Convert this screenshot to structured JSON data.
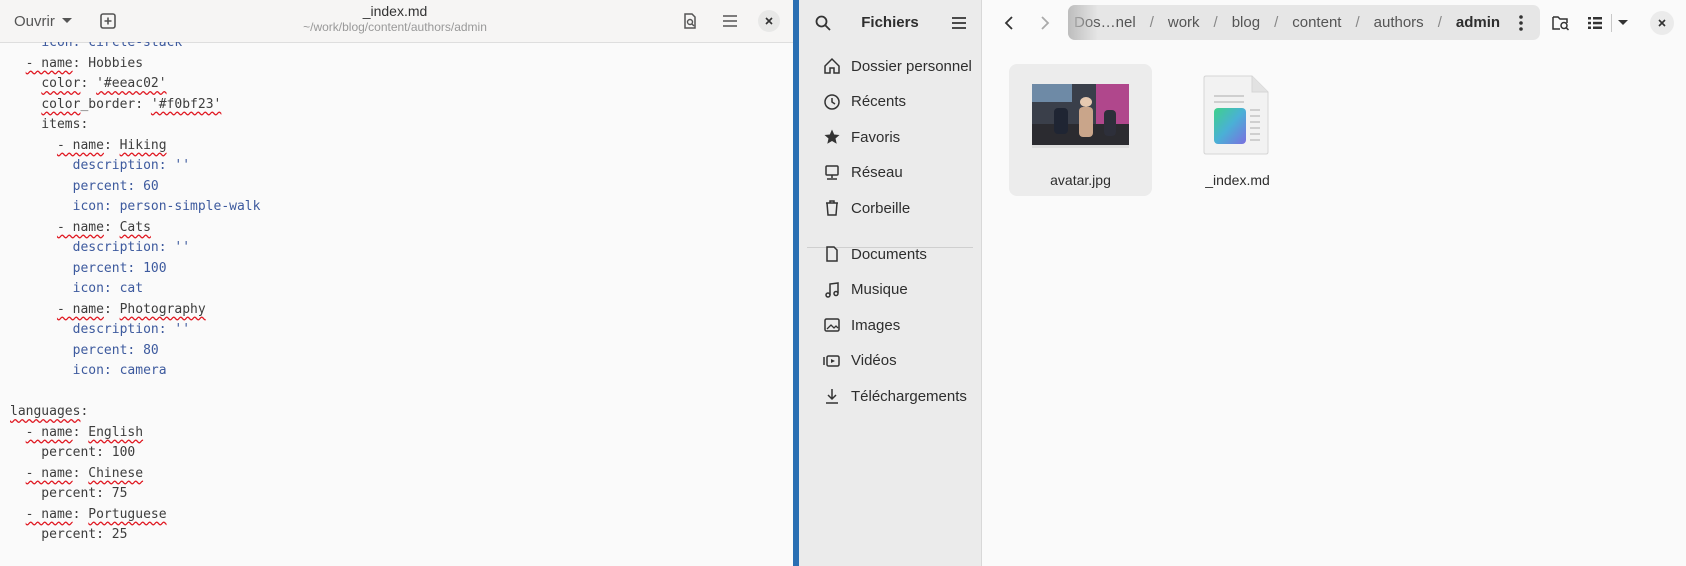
{
  "editor": {
    "open_label": "Ouvrir",
    "title": "_index.md",
    "subtitle": "~/work/blog/content/authors/admin",
    "lines": [
      {
        "tokens": [
          {
            "t": "    "
          },
          {
            "t": "icon: circle-stack",
            "c": "v"
          }
        ]
      },
      {
        "tokens": [
          {
            "t": "  "
          },
          {
            "t": "- name",
            "s": 1
          },
          {
            "t": ": Hobbies"
          }
        ]
      },
      {
        "tokens": [
          {
            "t": "    "
          },
          {
            "t": "color",
            "s": 1
          },
          {
            "t": ": "
          },
          {
            "t": "'#eeac02'",
            "s": 1
          }
        ]
      },
      {
        "tokens": [
          {
            "t": "    "
          },
          {
            "t": "color",
            "s": 1
          },
          {
            "t": "_border: "
          },
          {
            "t": "'#f0bf23'",
            "s": 1
          }
        ]
      },
      {
        "tokens": [
          {
            "t": "    items:"
          }
        ]
      },
      {
        "tokens": [
          {
            "t": "      "
          },
          {
            "t": "- name",
            "s": 1
          },
          {
            "t": ": "
          },
          {
            "t": "Hiking",
            "s": 1
          }
        ]
      },
      {
        "tokens": [
          {
            "t": "        "
          },
          {
            "t": "description: ''",
            "c": "v"
          }
        ]
      },
      {
        "tokens": [
          {
            "t": "        "
          },
          {
            "t": "percent: 60",
            "c": "v"
          }
        ]
      },
      {
        "tokens": [
          {
            "t": "        "
          },
          {
            "t": "icon: person-simple-walk",
            "c": "v"
          }
        ]
      },
      {
        "tokens": [
          {
            "t": "      "
          },
          {
            "t": "- name",
            "s": 1
          },
          {
            "t": ": "
          },
          {
            "t": "Cats",
            "s": 1
          }
        ]
      },
      {
        "tokens": [
          {
            "t": "        "
          },
          {
            "t": "description: ''",
            "c": "v"
          }
        ]
      },
      {
        "tokens": [
          {
            "t": "        "
          },
          {
            "t": "percent: 100",
            "c": "v"
          }
        ]
      },
      {
        "tokens": [
          {
            "t": "        "
          },
          {
            "t": "icon: cat",
            "c": "v"
          }
        ]
      },
      {
        "tokens": [
          {
            "t": "      "
          },
          {
            "t": "- name",
            "s": 1
          },
          {
            "t": ": "
          },
          {
            "t": "Photography",
            "s": 1
          }
        ]
      },
      {
        "tokens": [
          {
            "t": "        "
          },
          {
            "t": "description: ''",
            "c": "v"
          }
        ]
      },
      {
        "tokens": [
          {
            "t": "        "
          },
          {
            "t": "percent: 80",
            "c": "v"
          }
        ]
      },
      {
        "tokens": [
          {
            "t": "        "
          },
          {
            "t": "icon: camera",
            "c": "v"
          }
        ]
      },
      {
        "tokens": [
          {
            "t": ""
          }
        ]
      },
      {
        "tokens": [
          {
            "t": "languages",
            "s": 1
          },
          {
            "t": ":"
          }
        ]
      },
      {
        "tokens": [
          {
            "t": "  "
          },
          {
            "t": "- name",
            "s": 1
          },
          {
            "t": ": "
          },
          {
            "t": "English",
            "s": 1
          }
        ]
      },
      {
        "tokens": [
          {
            "t": "    percent: 100"
          }
        ]
      },
      {
        "tokens": [
          {
            "t": "  "
          },
          {
            "t": "- name",
            "s": 1
          },
          {
            "t": ": "
          },
          {
            "t": "Chinese",
            "s": 1
          }
        ]
      },
      {
        "tokens": [
          {
            "t": "    percent: 75"
          }
        ]
      },
      {
        "tokens": [
          {
            "t": "  "
          },
          {
            "t": "- name",
            "s": 1
          },
          {
            "t": ": "
          },
          {
            "t": "Portuguese",
            "s": 1
          }
        ]
      },
      {
        "tokens": [
          {
            "t": "    percent: 25"
          }
        ]
      }
    ]
  },
  "sidebar": {
    "title": "Fichiers",
    "places": [
      {
        "label": "Dossier personnel",
        "icon": "home-icon"
      },
      {
        "label": "Récents",
        "icon": "clock-icon"
      },
      {
        "label": "Favoris",
        "icon": "star-icon"
      },
      {
        "label": "Réseau",
        "icon": "network-icon"
      },
      {
        "label": "Corbeille",
        "icon": "trash-icon"
      }
    ],
    "folders": [
      {
        "label": "Documents",
        "icon": "document-icon"
      },
      {
        "label": "Musique",
        "icon": "music-icon"
      },
      {
        "label": "Images",
        "icon": "image-icon"
      },
      {
        "label": "Vidéos",
        "icon": "video-icon"
      },
      {
        "label": "Téléchargements",
        "icon": "download-icon"
      }
    ]
  },
  "files": {
    "breadcrumbs": [
      "Dos…nel",
      "work",
      "blog",
      "content",
      "authors",
      "admin"
    ],
    "items": [
      {
        "name": "avatar.jpg",
        "type": "image"
      },
      {
        "name": "_index.md",
        "type": "markdown"
      }
    ]
  }
}
